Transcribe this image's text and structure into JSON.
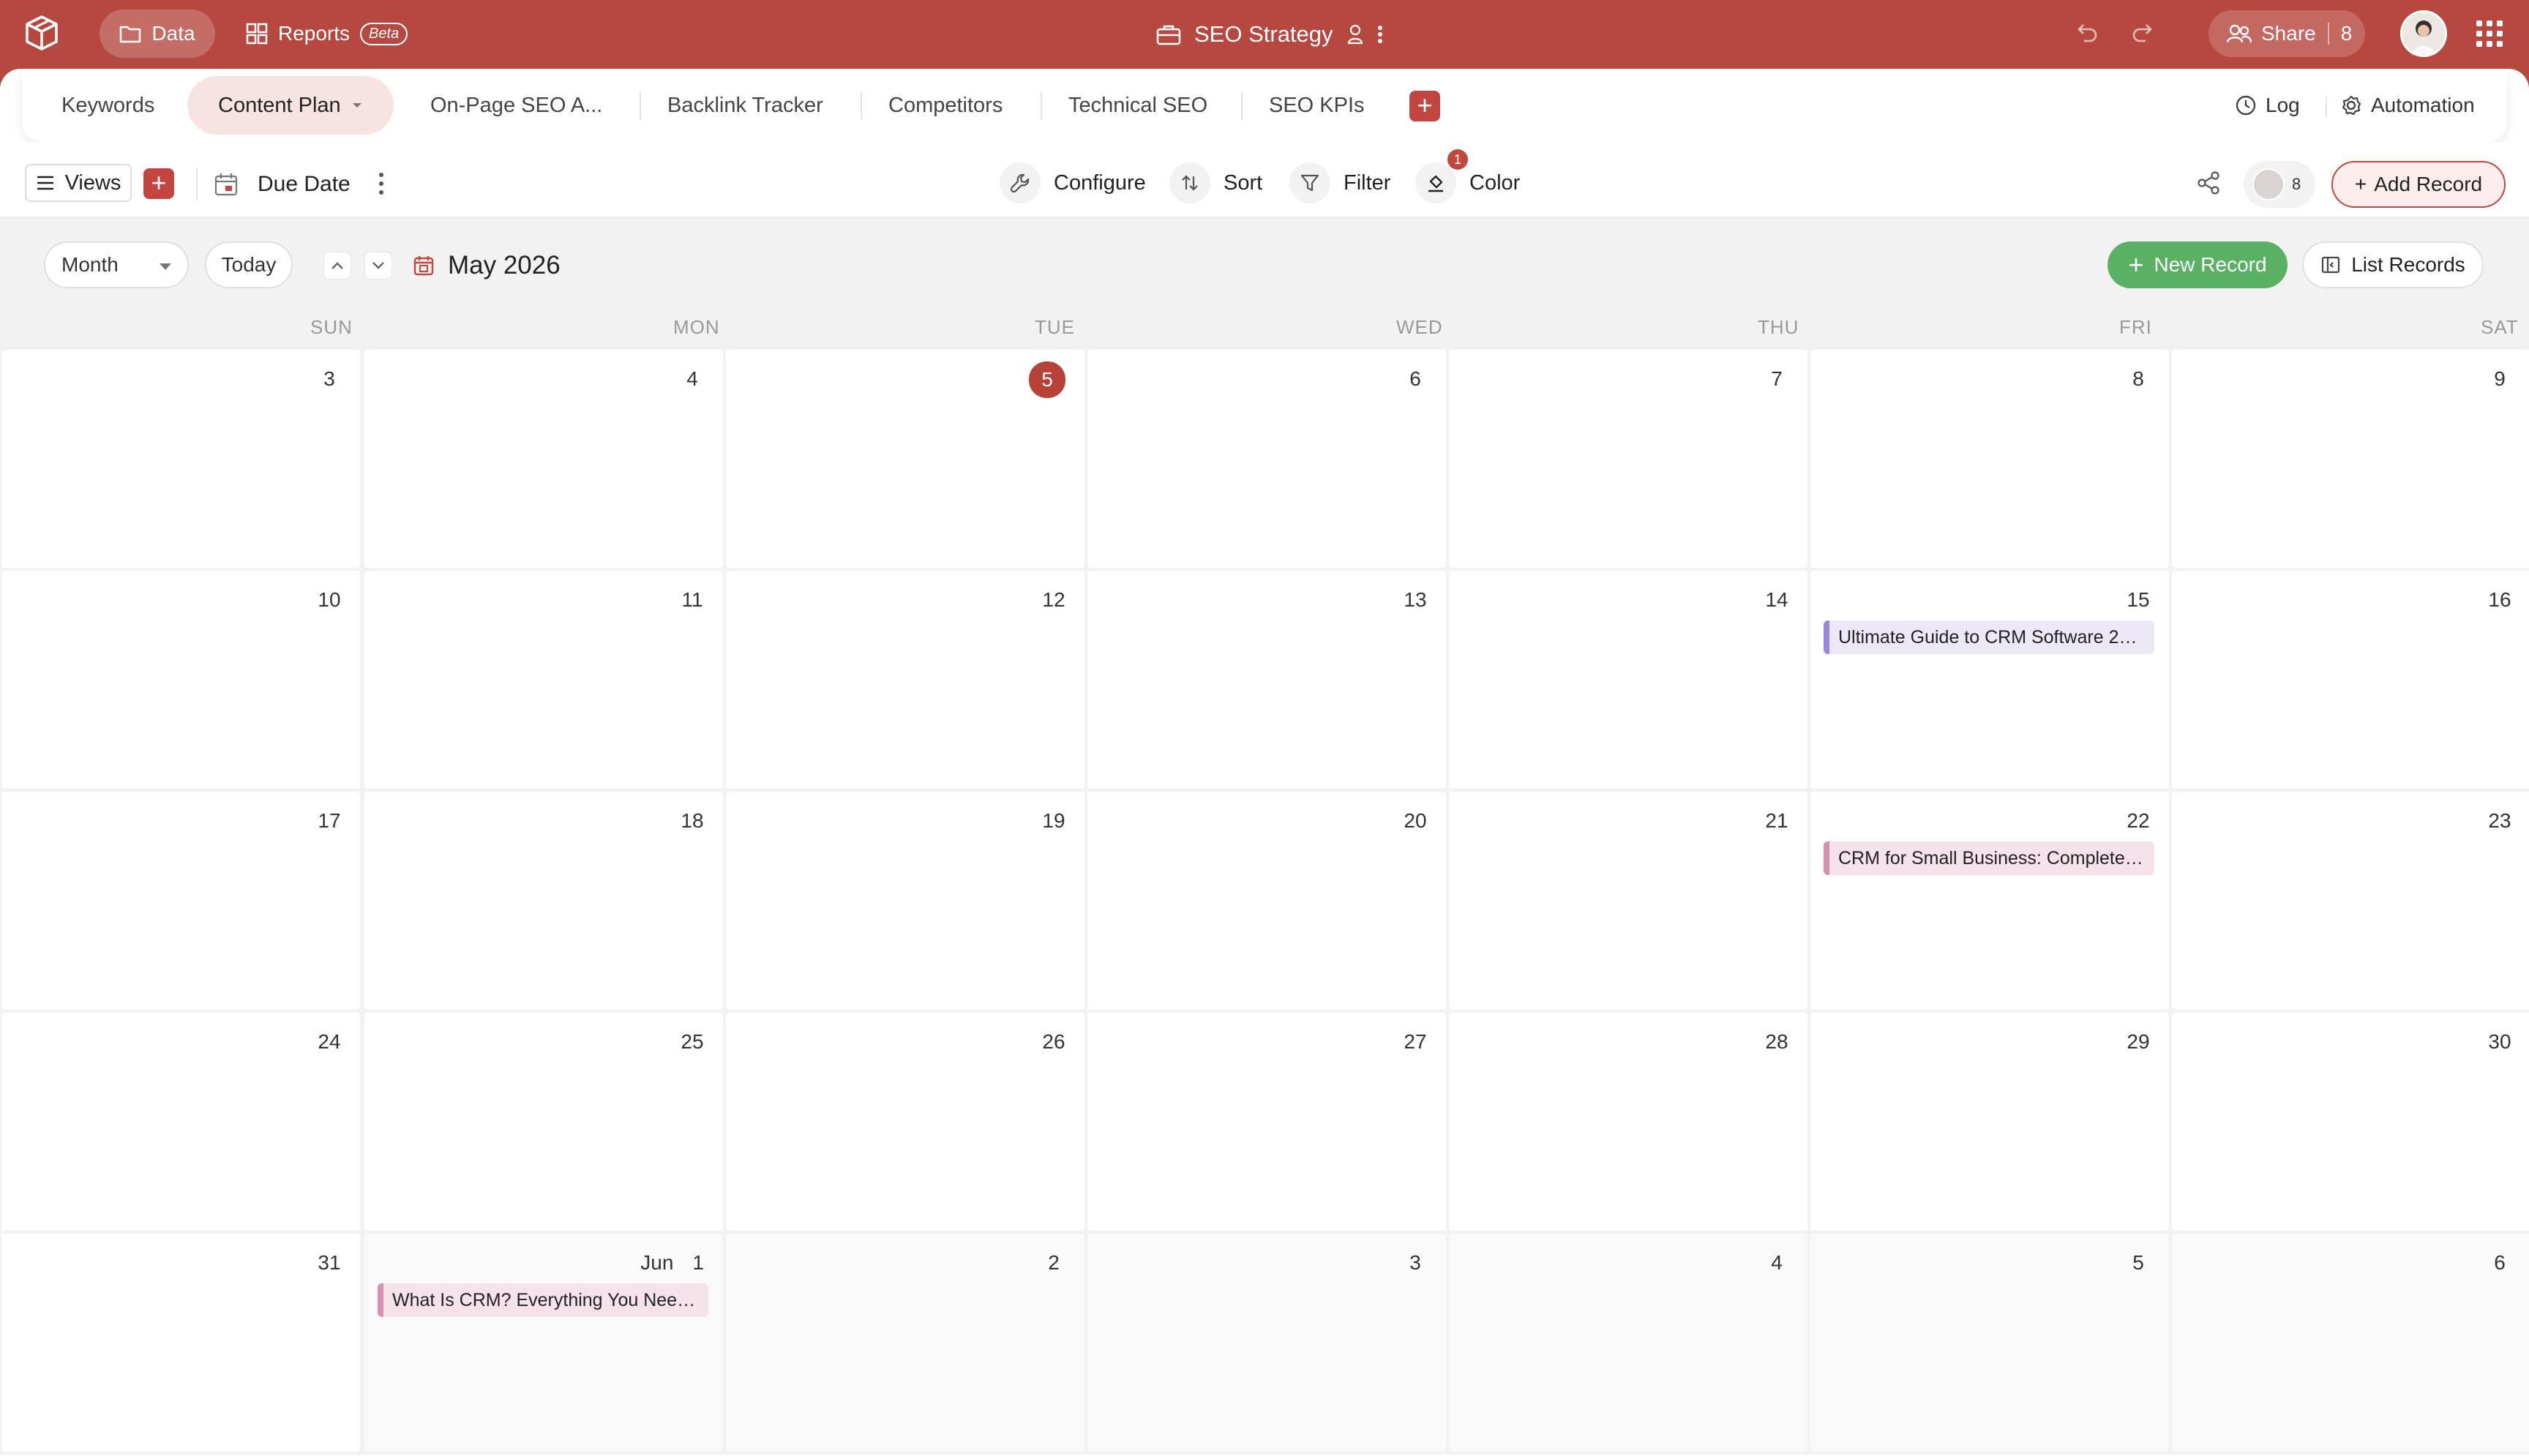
{
  "topbar": {
    "data_label": "Data",
    "reports_label": "Reports",
    "beta_label": "Beta",
    "base_title": "SEO Strategy",
    "share_label": "Share",
    "share_count": "8"
  },
  "tabs": [
    {
      "label": "Keywords"
    },
    {
      "label": "Content Plan",
      "active": true
    },
    {
      "label": "On-Page SEO A..."
    },
    {
      "label": "Backlink Tracker"
    },
    {
      "label": "Competitors"
    },
    {
      "label": "Technical SEO"
    },
    {
      "label": "SEO KPIs"
    }
  ],
  "tabs_right": {
    "log_label": "Log",
    "automation_label": "Automation"
  },
  "toolbar": {
    "views_label": "Views",
    "view_name": "Due Date",
    "configure_label": "Configure",
    "sort_label": "Sort",
    "filter_label": "Filter",
    "color_label": "Color",
    "color_badge": "1",
    "collaborator_count": "8",
    "add_record_label": "Add Record"
  },
  "calendar": {
    "mode_label": "Month",
    "today_label": "Today",
    "title": "May 2026",
    "new_record_label": "New Record",
    "list_records_label": "List Records",
    "weekdays": [
      "SUN",
      "MON",
      "TUE",
      "WED",
      "THU",
      "FRI",
      "SAT"
    ],
    "weeks": [
      [
        {
          "d": "3"
        },
        {
          "d": "4"
        },
        {
          "d": "5",
          "today": true
        },
        {
          "d": "6"
        },
        {
          "d": "7"
        },
        {
          "d": "8"
        },
        {
          "d": "9"
        }
      ],
      [
        {
          "d": "10"
        },
        {
          "d": "11"
        },
        {
          "d": "12"
        },
        {
          "d": "13"
        },
        {
          "d": "14"
        },
        {
          "d": "15",
          "event": "Ultimate Guide to CRM Software 2…",
          "event_color": "purple"
        },
        {
          "d": "16"
        }
      ],
      [
        {
          "d": "17"
        },
        {
          "d": "18"
        },
        {
          "d": "19"
        },
        {
          "d": "20"
        },
        {
          "d": "21"
        },
        {
          "d": "22",
          "event": "CRM for Small Business: Complete…",
          "event_color": "pink"
        },
        {
          "d": "23"
        }
      ],
      [
        {
          "d": "24"
        },
        {
          "d": "25"
        },
        {
          "d": "26"
        },
        {
          "d": "27"
        },
        {
          "d": "28"
        },
        {
          "d": "29"
        },
        {
          "d": "30"
        }
      ],
      [
        {
          "d": "31"
        },
        {
          "d": "1",
          "month": "Jun",
          "next": true,
          "event": "What Is CRM? Everything You Nee…",
          "event_color": "pink"
        },
        {
          "d": "2",
          "next": true
        },
        {
          "d": "3",
          "next": true
        },
        {
          "d": "4",
          "next": true
        },
        {
          "d": "5",
          "next": true
        },
        {
          "d": "6",
          "next": true
        }
      ]
    ]
  },
  "colors": {
    "brand": "#b64840",
    "accent_button": "#c2463f",
    "today_circle": "#b84138",
    "new_record_green": "#5ab164",
    "event_purple": "#9b87df",
    "event_pink": "#d98fae"
  },
  "icons": [
    "app-logo-icon",
    "folder-icon",
    "grid-icon",
    "briefcase-icon",
    "person-icon",
    "more-vertical-icon",
    "undo-icon",
    "redo-icon",
    "people-icon",
    "apps-grid-icon",
    "clock-icon",
    "gear-icon",
    "plus-icon",
    "menu-icon",
    "calendar-icon",
    "wrench-icon",
    "sort-icon",
    "filter-icon",
    "paint-bucket-icon",
    "share-nodes-icon",
    "chevron-up-icon",
    "chevron-down-icon",
    "list-icon"
  ]
}
